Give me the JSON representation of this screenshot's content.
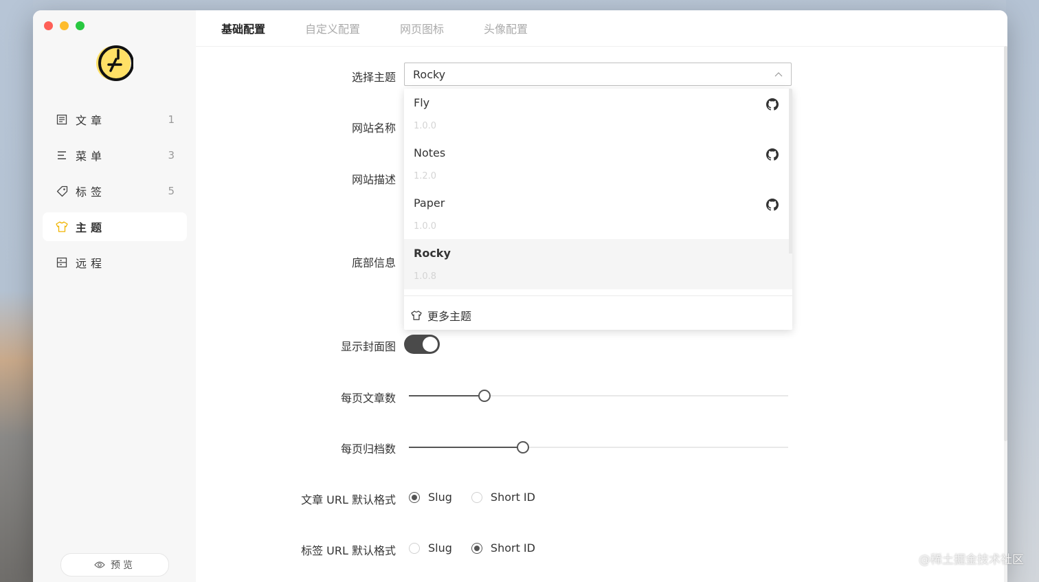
{
  "sidebar": {
    "items": [
      {
        "label": "文章",
        "count": "1",
        "icon": "article-icon"
      },
      {
        "label": "菜单",
        "count": "3",
        "icon": "menu-icon"
      },
      {
        "label": "标签",
        "count": "5",
        "icon": "tag-icon"
      },
      {
        "label": "主题",
        "count": "",
        "icon": "shirt-icon",
        "active": true
      },
      {
        "label": "远程",
        "count": "",
        "icon": "remote-icon"
      }
    ],
    "preview_label": "预览"
  },
  "tabs": [
    "基础配置",
    "自定义配置",
    "网页图标",
    "头像配置"
  ],
  "form": {
    "theme_label": "选择主题",
    "theme_value": "Rocky",
    "site_name_label": "网站名称",
    "site_desc_label": "网站描述",
    "footer_label": "底部信息",
    "cover_label": "显示封面图",
    "cover_on": true,
    "posts_per_page_label": "每页文章数",
    "posts_per_page_fraction": 0.2,
    "archives_per_page_label": "每页归档数",
    "archives_per_page_fraction": 0.3,
    "post_url_label": "文章 URL 默认格式",
    "tag_url_label": "标签 URL 默认格式",
    "radio_options": [
      "Slug",
      "Short ID"
    ],
    "post_url_selected": "Slug",
    "tag_url_selected": "Short ID"
  },
  "dropdown": {
    "options": [
      {
        "name": "Fly",
        "version": "1.0.0"
      },
      {
        "name": "Notes",
        "version": "1.2.0"
      },
      {
        "name": "Paper",
        "version": "1.0.0"
      },
      {
        "name": "Rocky",
        "version": "1.0.8",
        "selected": true
      }
    ],
    "more_label": "更多主题"
  },
  "watermark": "@稀土掘金技术社区"
}
